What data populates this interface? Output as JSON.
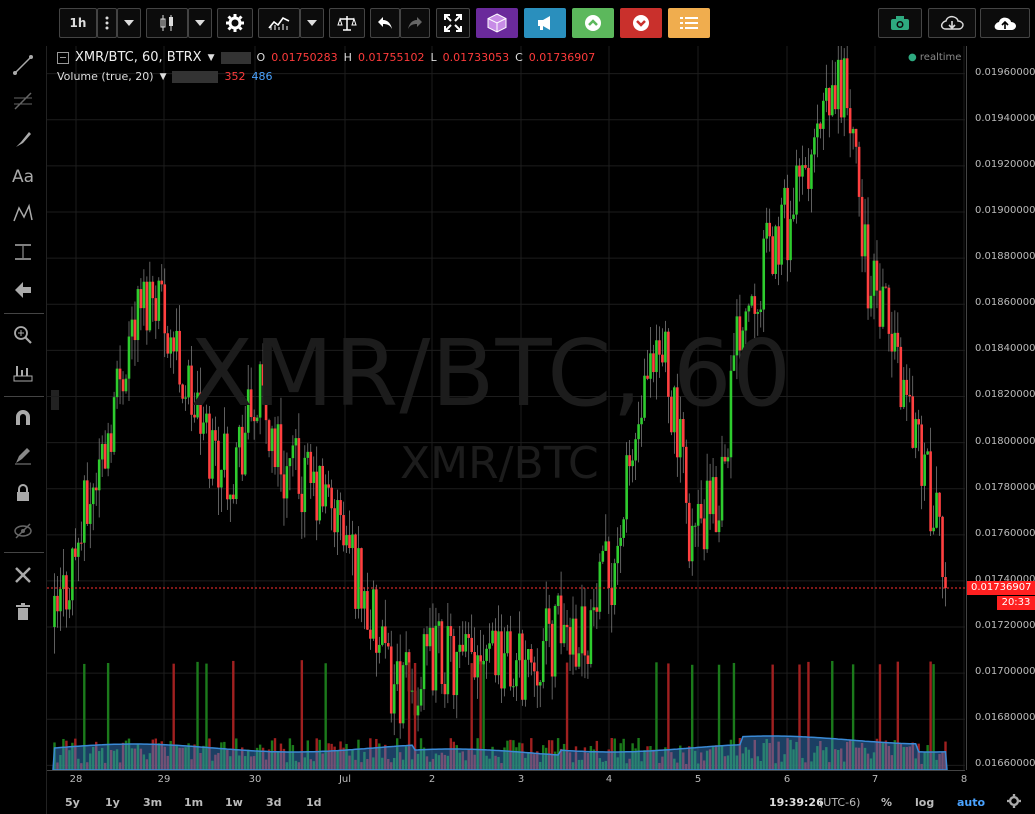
{
  "toolbar": {
    "interval": "1h",
    "colors": {
      "purple": "#6a2a9b",
      "blue": "#2a8fbd",
      "green": "#5cb85c",
      "red": "#c9302c",
      "orange": "#f0ad4e",
      "teal": "#2eaa80"
    }
  },
  "legend": {
    "symbol": "XMR/BTC, 60, BTRX",
    "o_label": "O",
    "o": "0.01750283",
    "h_label": "H",
    "h": "0.01755102",
    "l_label": "L",
    "l": "0.01733053",
    "c_label": "C",
    "c": "0.01736907",
    "volume": "Volume (true, 20)",
    "vol_val1": "352",
    "vol_val2": "486",
    "realtime": "realtime"
  },
  "watermark": {
    "big": "XMR/BTC, 60",
    "small": "XMR/BTC"
  },
  "price_axis": {
    "ticks": [
      "0.01960000",
      "0.01940000",
      "0.01920000",
      "0.01900000",
      "0.01880000",
      "0.01860000",
      "0.01840000",
      "0.01820000",
      "0.01800000",
      "0.01780000",
      "0.01760000",
      "0.01740000",
      "0.01720000",
      "0.01700000",
      "0.01680000",
      "0.01660000"
    ],
    "current_price": "0.01736907",
    "countdown": "20:33"
  },
  "time_axis": {
    "ticks": [
      "28",
      "29",
      "30",
      "Jul",
      "2",
      "3",
      "4",
      "5",
      "6",
      "7",
      "8"
    ]
  },
  "bottom_bar": {
    "ranges": [
      "5y",
      "1y",
      "3m",
      "1m",
      "1w",
      "3d",
      "1d"
    ],
    "clock": "19:39:26",
    "tz": "(UTC-6)",
    "percent": "%",
    "log": "log",
    "auto": "auto"
  },
  "chart_data": {
    "type": "candlestick",
    "symbol": "XMR/BTC",
    "interval": "60",
    "ylim": [
      0.0166,
      0.0197
    ],
    "x_ticks": [
      "28",
      "29",
      "30",
      "Jul",
      "2",
      "3",
      "4",
      "5",
      "6",
      "7",
      "8"
    ],
    "approx_closes": [
      0.0172,
      0.0176,
      0.018,
      0.0185,
      0.0187,
      0.0183,
      0.018,
      0.0179,
      0.0182,
      0.0179,
      0.0178,
      0.0177,
      0.0174,
      0.017,
      0.0169,
      0.0171,
      0.017,
      0.0172,
      0.017,
      0.0171,
      0.0172,
      0.0172,
      0.0175,
      0.0181,
      0.0184,
      0.0176,
      0.0177,
      0.0186,
      0.0188,
      0.019,
      0.0193,
      0.0196,
      0.0187,
      0.0184,
      0.018,
      0.0174
    ],
    "last": {
      "open": 0.01750283,
      "high": 0.01755102,
      "low": 0.01733053,
      "close": 0.01736907
    },
    "volume": {
      "name": "Volume (true, 20)",
      "last": 352,
      "ma": 486
    }
  }
}
